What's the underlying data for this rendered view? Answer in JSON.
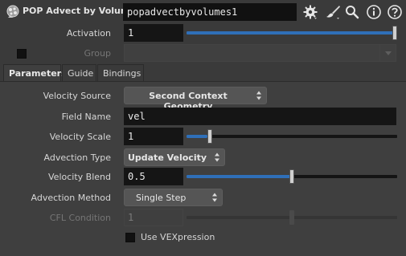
{
  "header": {
    "node_type": "POP Advect by Volumes",
    "node_name": "popadvectbyvolumes1",
    "icons": [
      "gear-icon",
      "brush-icon",
      "search-icon",
      "info-icon",
      "help-icon"
    ]
  },
  "activation": {
    "label": "Activation",
    "value": "1",
    "slider_fraction": 1.0
  },
  "group": {
    "label": "Group",
    "value": "",
    "enabled": false
  },
  "tabs": [
    {
      "label": "Parameters",
      "active": true
    },
    {
      "label": "Guide",
      "active": false
    },
    {
      "label": "Bindings",
      "active": false
    }
  ],
  "params": {
    "velocity_source": {
      "label": "Velocity Source",
      "value": "Second Context Geometry"
    },
    "field_name": {
      "label": "Field Name",
      "value": "vel"
    },
    "velocity_scale": {
      "label": "Velocity Scale",
      "value": "1",
      "slider_fraction": 0.1
    },
    "advection_type": {
      "label": "Advection Type",
      "value": "Update Velocity"
    },
    "velocity_blend": {
      "label": "Velocity Blend",
      "value": "0.5",
      "slider_fraction": 0.5
    },
    "advection_method": {
      "label": "Advection Method",
      "value": "Single Step"
    },
    "cfl_condition": {
      "label": "CFL Condition",
      "value": "1",
      "slider_fraction": 0.5,
      "enabled": false
    },
    "use_vexpression": {
      "label": "Use VEXpression",
      "checked": false
    }
  },
  "colors": {
    "background": "#3a3a3a",
    "panel": "#3f3f3f",
    "field": "#151515",
    "slider_fill": "#2f6fb8",
    "menu": "#555555",
    "text": "#d6d6d6",
    "disabled_text": "#757575"
  }
}
